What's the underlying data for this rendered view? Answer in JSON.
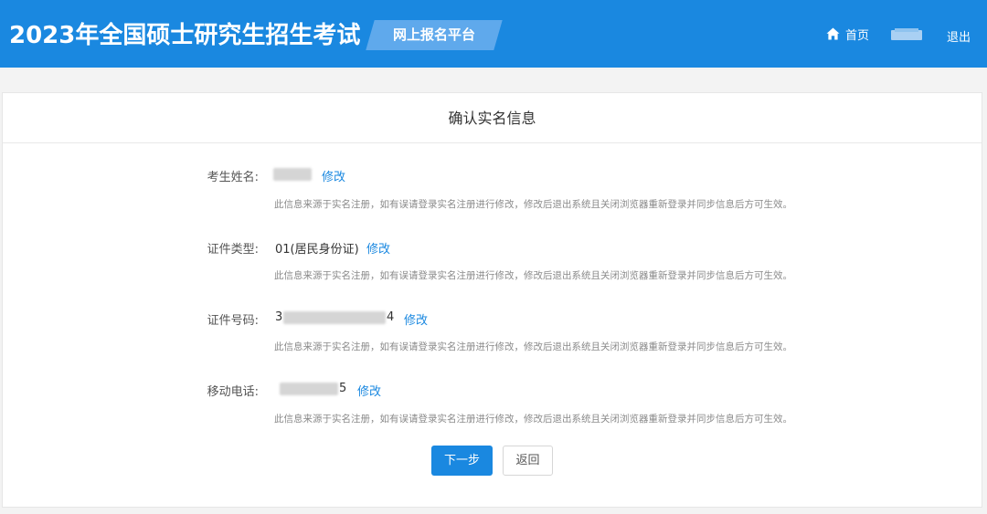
{
  "header": {
    "title": "2023年全国硕士研究生招生考试",
    "platform": "网上报名平台",
    "nav_home": "首页",
    "nav_logout": "退出",
    "accent_color": "#1a88e0"
  },
  "card": {
    "title": "确认实名信息"
  },
  "fields": [
    {
      "label": "考生姓名:",
      "value": "",
      "edit_label": "修改",
      "note": "此信息来源于实名注册，如有误请登录实名注册进行修改，修改后退出系统且关闭浏览器重新登录并同步信息后方可生效。"
    },
    {
      "label": "证件类型:",
      "value": "01(居民身份证)",
      "edit_label": "修改",
      "note": "此信息来源于实名注册，如有误请登录实名注册进行修改，修改后退出系统且关闭浏览器重新登录并同步信息后方可生效。"
    },
    {
      "label": "证件号码:",
      "value_prefix": "3",
      "value_suffix": "4",
      "edit_label": "修改",
      "note": "此信息来源于实名注册，如有误请登录实名注册进行修改，修改后退出系统且关闭浏览器重新登录并同步信息后方可生效。"
    },
    {
      "label": "移动电话:",
      "value_suffix": "5",
      "edit_label": "修改",
      "note": "此信息来源于实名注册，如有误请登录实名注册进行修改，修改后退出系统且关闭浏览器重新登录并同步信息后方可生效。"
    }
  ],
  "actions": {
    "next_label": "下一步",
    "back_label": "返回"
  },
  "icons": {
    "home": "home-icon"
  }
}
